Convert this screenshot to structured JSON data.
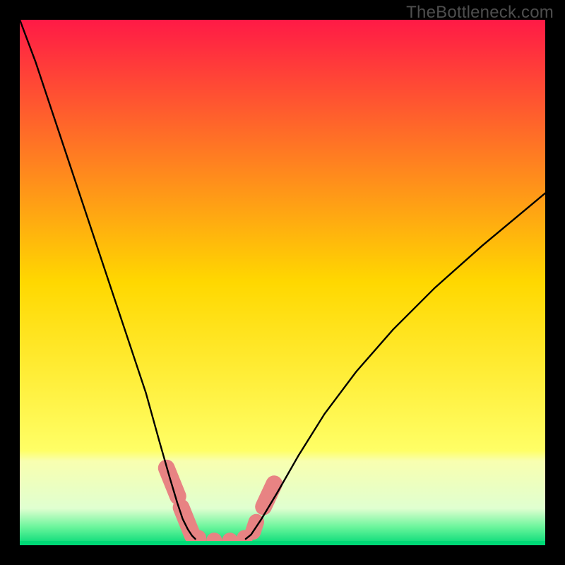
{
  "watermark": "TheBottleneck.com",
  "chart_data": {
    "type": "line",
    "title": "",
    "xlabel": "",
    "ylabel": "",
    "xlim": [
      0,
      100
    ],
    "ylim": [
      0,
      100
    ],
    "background_gradient": {
      "stops": [
        {
          "offset": 0.0,
          "color": "#ff1a46"
        },
        {
          "offset": 0.5,
          "color": "#ffd800"
        },
        {
          "offset": 0.82,
          "color": "#ffff66"
        },
        {
          "offset": 0.84,
          "color": "#f8ffb0"
        },
        {
          "offset": 0.93,
          "color": "#e0ffd0"
        },
        {
          "offset": 0.965,
          "color": "#6cf59c"
        },
        {
          "offset": 1.0,
          "color": "#00d976"
        }
      ]
    },
    "series": [
      {
        "name": "left-curve",
        "color": "#000000",
        "x": [
          0,
          3,
          6,
          9,
          12,
          15,
          18,
          21,
          24,
          26.5,
          28.5,
          30,
          31,
          32,
          32.8,
          33.4
        ],
        "y": [
          100,
          92,
          83,
          74,
          65,
          56,
          47,
          38,
          29,
          20,
          13,
          8,
          5,
          3,
          1.8,
          1.2
        ]
      },
      {
        "name": "right-curve",
        "color": "#000000",
        "x": [
          43,
          44,
          46,
          49,
          53,
          58,
          64,
          71,
          79,
          88,
          100
        ],
        "y": [
          1.2,
          2,
          5,
          10,
          17,
          25,
          33,
          41,
          49,
          57,
          67
        ]
      },
      {
        "name": "floor-stripe",
        "color": "#00d976",
        "x": [
          0,
          100
        ],
        "y": [
          0.4,
          0.4
        ]
      }
    ],
    "markers": [
      {
        "name": "pink-left-upper",
        "type": "rounded-rect",
        "color": "#e88383",
        "cx": 29.0,
        "cy": 12.0,
        "w": 3.2,
        "h": 9.0,
        "rot": -22
      },
      {
        "name": "pink-left-lower",
        "type": "rounded-rect",
        "color": "#e88383",
        "cx": 31.8,
        "cy": 4.5,
        "w": 3.2,
        "h": 9.0,
        "rot": -22
      },
      {
        "name": "pink-valley-1",
        "type": "rounded-rect",
        "color": "#e88383",
        "cx": 34.0,
        "cy": 1.3,
        "w": 3.0,
        "h": 3.2,
        "rot": 0
      },
      {
        "name": "pink-valley-2",
        "type": "rounded-rect",
        "color": "#e88383",
        "cx": 37.0,
        "cy": 0.9,
        "w": 3.0,
        "h": 3.0,
        "rot": 0
      },
      {
        "name": "pink-valley-3",
        "type": "rounded-rect",
        "color": "#e88383",
        "cx": 40.0,
        "cy": 0.9,
        "w": 3.0,
        "h": 3.0,
        "rot": 0
      },
      {
        "name": "pink-valley-4",
        "type": "rounded-rect",
        "color": "#e88383",
        "cx": 42.8,
        "cy": 1.3,
        "w": 3.0,
        "h": 3.2,
        "rot": 0
      },
      {
        "name": "pink-right-lower",
        "type": "rounded-rect",
        "color": "#e88383",
        "cx": 44.7,
        "cy": 3.5,
        "w": 3.0,
        "h": 5.0,
        "rot": 18
      },
      {
        "name": "pink-right-upper",
        "type": "rounded-rect",
        "color": "#e88383",
        "cx": 47.4,
        "cy": 9.5,
        "w": 3.2,
        "h": 8.0,
        "rot": 25
      }
    ]
  }
}
